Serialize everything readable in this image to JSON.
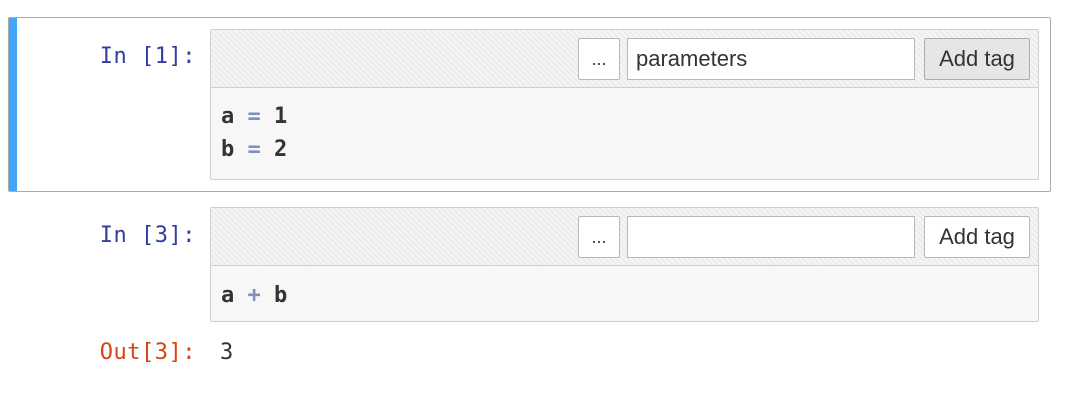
{
  "cells": [
    {
      "prompt": "In [1]:",
      "tag_more_label": "...",
      "tag_input_value": "parameters",
      "add_tag_label": "Add tag",
      "code": [
        {
          "left": "a",
          "op": "=",
          "right": "1"
        },
        {
          "left": "b",
          "op": "=",
          "right": "2"
        }
      ]
    },
    {
      "prompt": "In [3]:",
      "tag_more_label": "...",
      "tag_input_value": "",
      "add_tag_label": "Add tag",
      "code": [
        {
          "left": "a",
          "op": "+",
          "right": "b"
        }
      ],
      "output_prompt": "Out[3]:",
      "output_value": "3"
    }
  ],
  "colors": {
    "selected_cell_bar": "#42a5f5",
    "in_prompt": "#303f9f",
    "out_prompt": "#d84315",
    "operator": "#7f8fbf"
  }
}
